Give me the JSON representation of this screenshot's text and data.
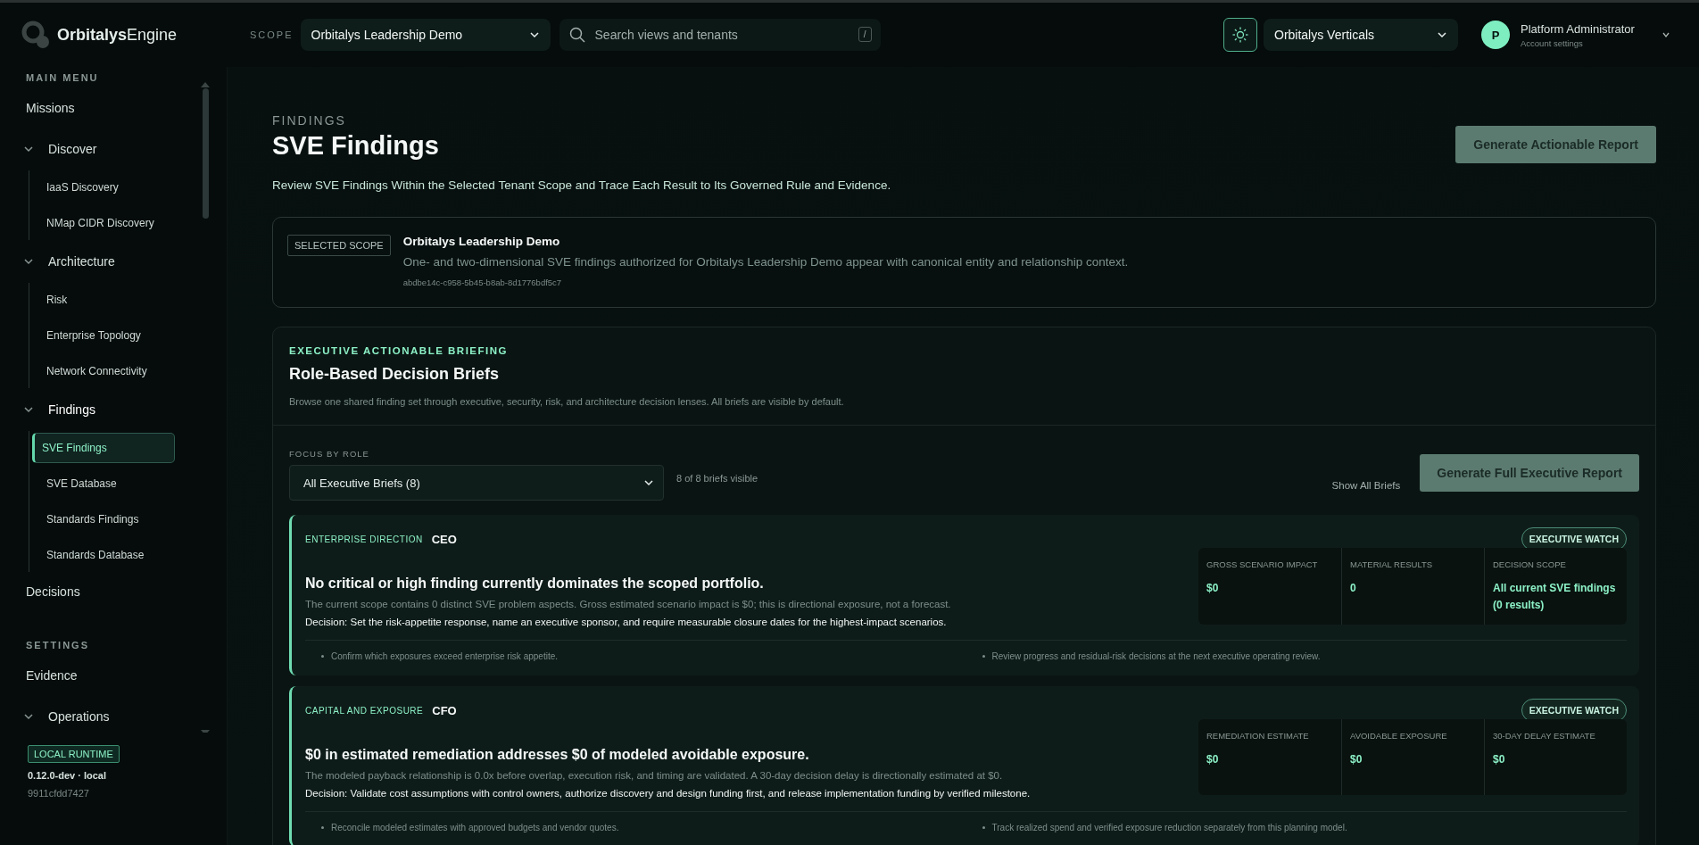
{
  "topbar": {
    "brand": "**Orbitalys**Engine",
    "scope_label": "SCOPE",
    "scope_value": "Orbitalys Leadership Demo",
    "search": {
      "placeholder": "Search views and tenants",
      "shortcut": "/"
    },
    "vertical_value": "Orbitalys Verticals",
    "user": {
      "initial": "P",
      "name": "Platform Administrator",
      "subtitle": "Account settings"
    }
  },
  "sidebar": {
    "sections": [
      {
        "label": "MAIN MENU",
        "items": [
          {
            "kind": "link",
            "label": "Missions",
            "selected": false
          },
          {
            "kind": "group",
            "label": "Discover",
            "expanded": true,
            "children": [
              {
                "label": "IaaS Discovery",
                "selected": false
              },
              {
                "label": "NMap CIDR Discovery",
                "selected": false
              }
            ]
          },
          {
            "kind": "group",
            "label": "Architecture",
            "expanded": true,
            "children": [
              {
                "label": "Risk",
                "selected": false
              },
              {
                "label": "Enterprise Topology",
                "selected": false
              },
              {
                "label": "Network Connectivity",
                "selected": false
              }
            ]
          },
          {
            "kind": "group",
            "label": "Findings",
            "expanded": true,
            "children": [
              {
                "label": "SVE Findings",
                "selected": true
              },
              {
                "label": "SVE Database",
                "selected": false
              },
              {
                "label": "Standards Findings",
                "selected": false
              },
              {
                "label": "Standards Database",
                "selected": false
              }
            ]
          },
          {
            "kind": "link",
            "label": "Decisions",
            "selected": false
          }
        ]
      },
      {
        "label": "SETTINGS",
        "items": [
          {
            "kind": "link",
            "label": "Evidence",
            "selected": false
          },
          {
            "kind": "group",
            "label": "Operations",
            "expanded": true
          }
        ]
      }
    ],
    "runtime": {
      "badge": "LOCAL RUNTIME",
      "version": "0.12.0-dev · local",
      "build": "9911cfdd7427"
    }
  },
  "page": {
    "eyebrow": "FINDINGS",
    "title": "SVE Findings",
    "subtitle": "Review SVE Findings Within the Selected Tenant Scope and Trace Each Result to Its Governed Rule and Evidence.",
    "action": "Generate Actionable Report"
  },
  "scope_card": {
    "tag": "SELECTED SCOPE",
    "name": "Orbitalys Leadership Demo",
    "description": "One- and two-dimensional SVE findings authorized for Orbitalys Leadership Demo appear with canonical entity and relationship context.",
    "id": "abdbe14c-c958-5b45-b8ab-8d1776bdf5c7"
  },
  "briefing": {
    "eyebrow": "EXECUTIVE ACTIONABLE BRIEFING",
    "title": "Role-Based Decision Briefs",
    "description": "Browse one shared finding set through executive, security, risk, and architecture decision lenses. All briefs are visible by default.",
    "filter_label": "FOCUS BY ROLE",
    "filter_value": "All Executive Briefs (8)",
    "visible_count": "8 of 8 briefs visible",
    "show_all": "Show All Briefs",
    "action": "Generate Full Executive Report",
    "briefs": [
      {
        "category": "ENTERPRISE DIRECTION",
        "role": "CEO",
        "badge": "EXECUTIVE WATCH",
        "headline": "No critical or high finding currently dominates the scoped portfolio.",
        "summary": "The current scope contains 0 distinct SVE problem aspects. Gross estimated scenario impact is $0; this is directional exposure, not a forecast.",
        "decision": "Decision: Set the risk-appetite response, name an executive sponsor, and require measurable closure dates for the highest-impact scenarios.",
        "metrics": [
          {
            "label": "GROSS SCENARIO IMPACT",
            "value": "$0"
          },
          {
            "label": "MATERIAL RESULTS",
            "value": "0"
          },
          {
            "label": "DECISION SCOPE",
            "value": "All current SVE findings (0 results)"
          }
        ],
        "actions": [
          "Confirm which exposures exceed enterprise risk appetite.",
          "Review progress and residual-risk decisions at the next executive operating review."
        ]
      },
      {
        "category": "CAPITAL AND EXPOSURE",
        "role": "CFO",
        "badge": "EXECUTIVE WATCH",
        "headline": "$0 in estimated remediation addresses $0 of modeled avoidable exposure.",
        "summary": "The modeled payback relationship is 0.0x before overlap, execution risk, and timing are validated. A 30-day decision delay is directionally estimated at $0.",
        "decision": "Decision: Validate cost assumptions with control owners, authorize discovery and design funding first, and release implementation funding by verified milestone.",
        "metrics": [
          {
            "label": "REMEDIATION ESTIMATE",
            "value": "$0"
          },
          {
            "label": "AVOIDABLE EXPOSURE",
            "value": "$0"
          },
          {
            "label": "30-DAY DELAY ESTIMATE",
            "value": "$0"
          }
        ],
        "actions": [
          "Reconcile modeled estimates with approved budgets and vendor quotes.",
          "Track realized spend and verified exposure reduction separately from this planning model."
        ]
      }
    ]
  }
}
